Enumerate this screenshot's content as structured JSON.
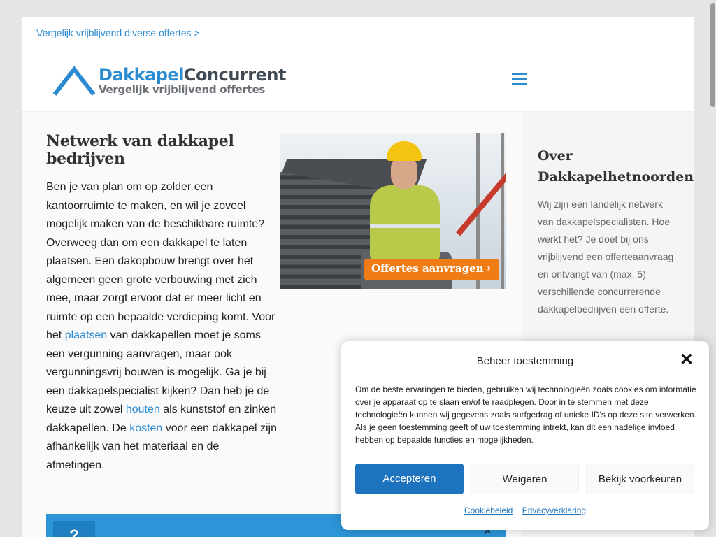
{
  "topbar": {
    "link": "Vergelijk vrijblijvend diverse offertes >"
  },
  "logo": {
    "part1": "Dakkapel",
    "part2": "Concurrent",
    "tagline": "Vergelijk vrijblijvend offertes"
  },
  "main": {
    "heading": "Netwerk van dakkapel bedrijven",
    "p1_a": "Ben je van plan om op zolder een kantoorruimte te maken, en wil je zoveel mogelijk maken van de beschikbare ruimte? Overweeg dan om een dakkapel te laten plaatsen. Een dakopbouw brengt over het algemeen geen grote verbouwing met zich mee, maar zorgt ervoor dat er meer licht en ruimte op een bepaalde verdieping komt. Voor het ",
    "link_plaatsen": "plaatsen",
    "p1_b": " van dakkapellen moet je soms een vergunning aanvragen, maar ook vergunningsvrij bouwen is mogelijk. Ga je bij een dakkapelspecialist kijken? Dan heb je de keuze uit zowel ",
    "link_houten": "houten",
    "p1_c": " als kunststof en zinken dakkapellen. De ",
    "link_kosten": "kosten",
    "p1_d": " voor een dakkapel zijn afhankelijk van het materiaal en de afmetingen."
  },
  "cta": {
    "label": "Offertes aanvragen",
    "chevron": "›"
  },
  "sidebar": {
    "heading": "Over Dakkapelhetnoorden.nl",
    "text": "Wij zijn een landelijk netwerk van dakkapelspecialisten. Hoe werkt het? Je doet bij ons vrijblijvend een offerteaanvraag en ontvangt van (max. 5) verschillende concurrerende dakkapelbedrijven een offerte."
  },
  "bluebar": {
    "badge": "?",
    "close": "×"
  },
  "cookie": {
    "title": "Beheer toestemming",
    "close": "✕",
    "body": "Om de beste ervaringen te bieden, gebruiken wij technologieën zoals cookies om informatie over je apparaat op te slaan en/of te raadplegen. Door in te stemmen met deze technologieën kunnen wij gegevens zoals surfgedrag of unieke ID's op deze site verwerken. Als je geen toestemming geeft of uw toestemming intrekt, kan dit een nadelige invloed hebben op bepaalde functies en mogelijkheden.",
    "accept": "Accepteren",
    "deny": "Weigeren",
    "prefs": "Bekijk voorkeuren",
    "link_cookie": "Cookiebeleid",
    "link_privacy": "Privacyverklaring"
  },
  "colors": {
    "accent": "#2a8bd0",
    "cta": "#f07c16",
    "accept": "#1e73be"
  }
}
